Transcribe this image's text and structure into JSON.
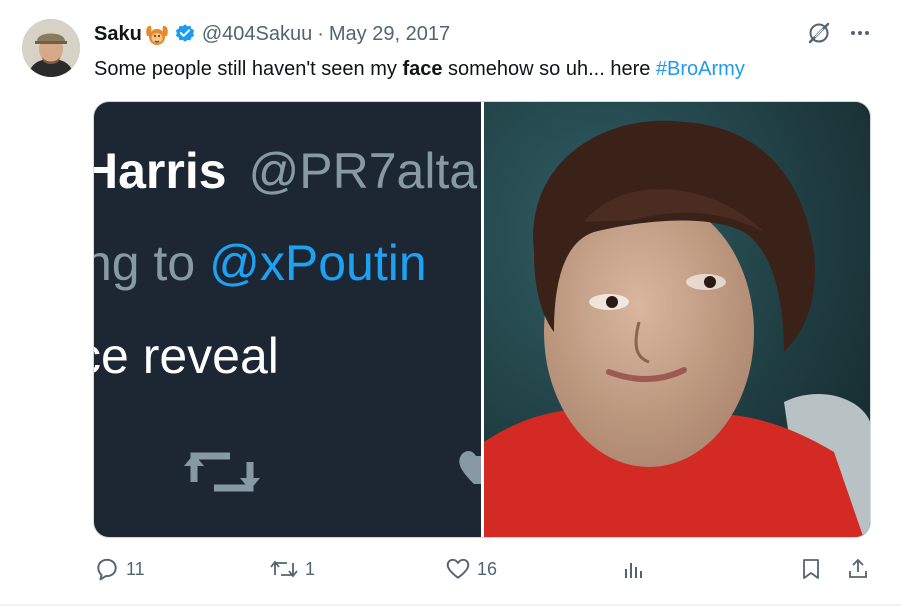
{
  "author": {
    "display_name": "Saku",
    "emoji_icon": "monkey-hands-up-icon",
    "verified_icon": "verified-badge-icon",
    "handle": "@404Sakuu",
    "separator": "·",
    "date": "May 29, 2017"
  },
  "tweet": {
    "text_before": "Some people still haven't seen my ",
    "text_bold": "face",
    "text_after": " somehow so uh... here ",
    "hashtag": "#BroArmy"
  },
  "media": {
    "screenshot_name": "Harris",
    "screenshot_handle": "@PR7alta",
    "screenshot_reply_prefix": "ng to ",
    "screenshot_reply_mention": "@xPoutin",
    "screenshot_body": "ce reveal"
  },
  "actions": {
    "reply_count": "11",
    "retweet_count": "1",
    "like_count": "16"
  },
  "colors": {
    "accent": "#1d9bf0",
    "text_primary": "#0f1419",
    "text_secondary": "#536471",
    "media_dark": "#1c2733",
    "shirt_red": "#d42a24"
  }
}
